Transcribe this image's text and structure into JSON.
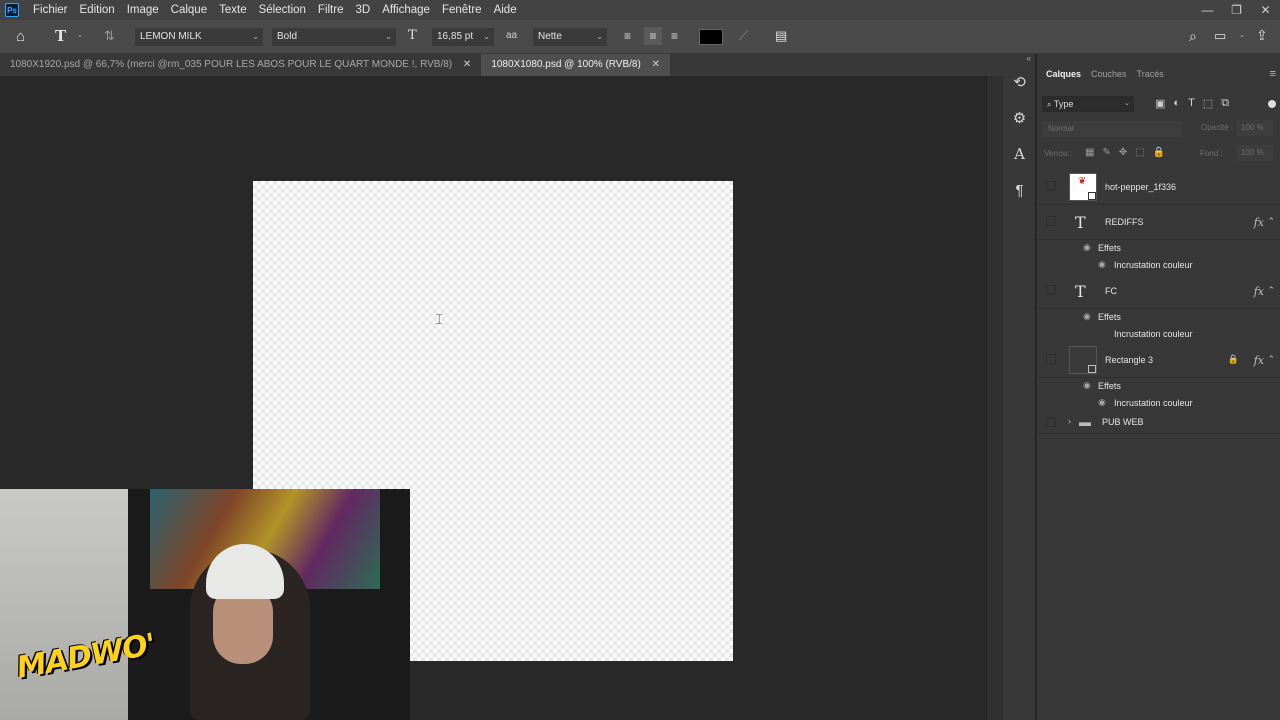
{
  "menubar": {
    "app_logo": "Ps",
    "items": [
      "Fichier",
      "Edition",
      "Image",
      "Calque",
      "Texte",
      "Sélection",
      "Filtre",
      "3D",
      "Affichage",
      "Fenêtre",
      "Aide"
    ],
    "window_controls": [
      "—",
      "❐",
      "✕"
    ]
  },
  "options": {
    "font_family": "LEMON MILK",
    "font_style": "Bold",
    "font_size": "16,85 pt",
    "antialias_icon": "aa",
    "antialias": "Nette",
    "text_color": "#000000"
  },
  "tabs": [
    {
      "label": "1080X1920.psd @ 66,7% (merci @rm_035 POUR LES ABOS POUR LE QUART MONDE !, RVB/8)",
      "close": "✕",
      "active": false
    },
    {
      "label": "1080X1080.psd @ 100% (RVB/8)",
      "close": "✕",
      "active": true
    }
  ],
  "panel": {
    "tabs": [
      "Calques",
      "Couches",
      "Tracés"
    ],
    "filter_label": "Type",
    "blend_mode": "Normal",
    "opacity_label": "Opacité :",
    "opacity_value": "100 %",
    "lock_label": "Verrou :",
    "fill_label": "Fond :",
    "fill_value": "100 %"
  },
  "layers": [
    {
      "name": "hot-pepper_1f336",
      "kind": "smart"
    },
    {
      "name": "REDIFFS",
      "kind": "text",
      "fx": "fx",
      "effects_label": "Effets",
      "effect": "Incrustation couleur"
    },
    {
      "name": "FC",
      "kind": "text",
      "fx": "fx",
      "effects_label": "Effets",
      "effect": "Incrustation couleur"
    },
    {
      "name": "Rectangle 3",
      "kind": "shape",
      "fx": "fx",
      "effects_label": "Effets",
      "effect": "Incrustation couleur"
    },
    {
      "name": "PUB WEB",
      "kind": "group"
    }
  ],
  "webcam": {
    "overlay_text": "MADWO'"
  }
}
